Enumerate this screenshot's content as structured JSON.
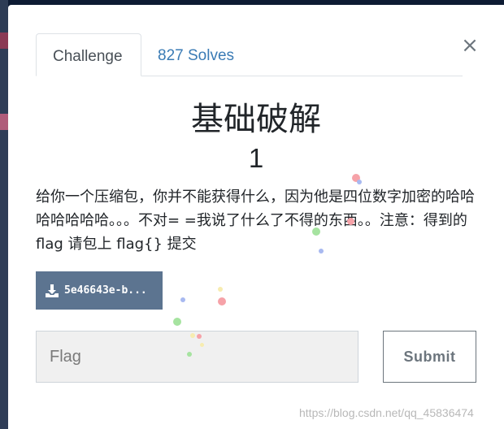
{
  "tabs": [
    {
      "label": "Challenge",
      "active": true
    },
    {
      "label": "827 Solves",
      "active": false
    }
  ],
  "close_label": "×",
  "challenge": {
    "name": "基础破解",
    "value": "1",
    "description": "给你一个压缩包，你并不能获得什么，因为他是四位数字加密的哈哈哈哈哈哈哈。。。不对= =我说了什么了不得的东西。。注意：得到的 flag 请包上 flag{} 提交"
  },
  "file": {
    "label": "5e46643e-b...",
    "icon": "download-icon"
  },
  "flag_input": {
    "placeholder": "Flag",
    "value": ""
  },
  "submit_label": "Submit",
  "watermark": "https://blog.csdn.net/qq_45836474",
  "colors": {
    "file_button": "#5c7490",
    "link": "#3a7bb5",
    "input_bg": "#f0f0f0"
  }
}
